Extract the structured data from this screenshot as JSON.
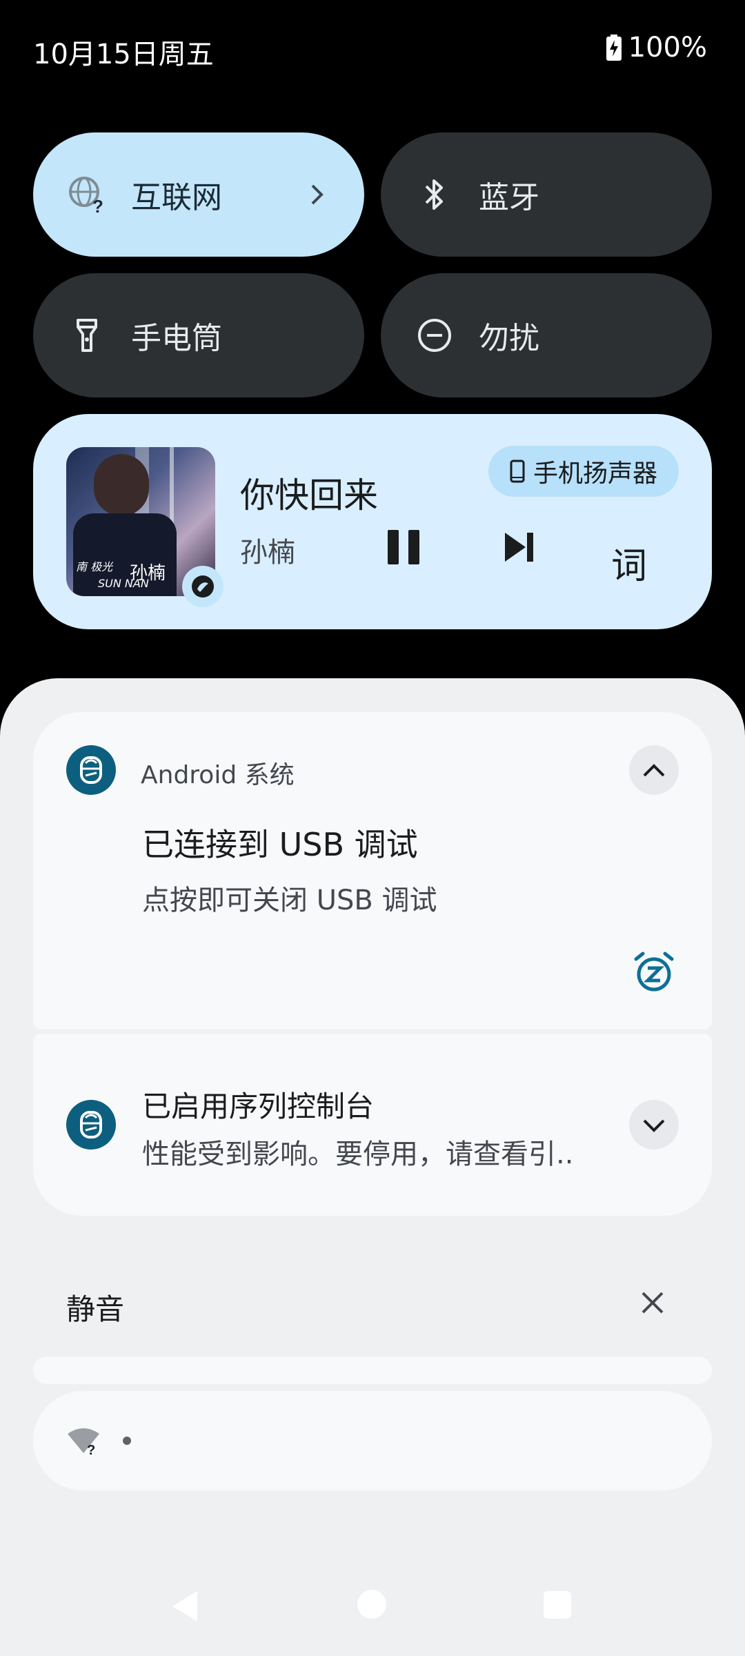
{
  "status_bar": {
    "datetime": "10月15日周五",
    "battery_percent": "100%"
  },
  "quick_tiles": [
    {
      "label": "互联网",
      "icon": "globe-question-icon",
      "active": true,
      "has_chevron": true
    },
    {
      "label": "蓝牙",
      "icon": "bluetooth-icon",
      "active": false
    },
    {
      "label": "手电筒",
      "icon": "flashlight-icon",
      "active": false
    },
    {
      "label": "勿扰",
      "icon": "do-not-disturb-icon",
      "active": false
    }
  ],
  "media": {
    "title": "你快回来",
    "artist": "孙楠",
    "output_device": "手机扬声器",
    "lyrics_label": "词",
    "album_art_text": "孙楠",
    "album_art_text2": "SUN NAN",
    "album_art_text3": "南 极光",
    "app_badge_icon": "music-app-icon",
    "play_state": "playing"
  },
  "notifications": [
    {
      "app": "Android 系统",
      "title": "已连接到 USB 调试",
      "body": "点按即可关闭 USB 调试",
      "expanded": true,
      "snooze_icon": "snooze-alarm-icon"
    },
    {
      "title": "已启用序列控制台",
      "body": "性能受到影响。要停用，请查看引..",
      "expanded": false
    }
  ],
  "silent_section": {
    "label": "静音"
  },
  "colors": {
    "tile_active": "#c4e6fb",
    "tile_inactive": "#2d3033",
    "media_bg": "#d9efff",
    "shade_bg": "#eff0f2",
    "app_icon": "#0d5f7f"
  }
}
